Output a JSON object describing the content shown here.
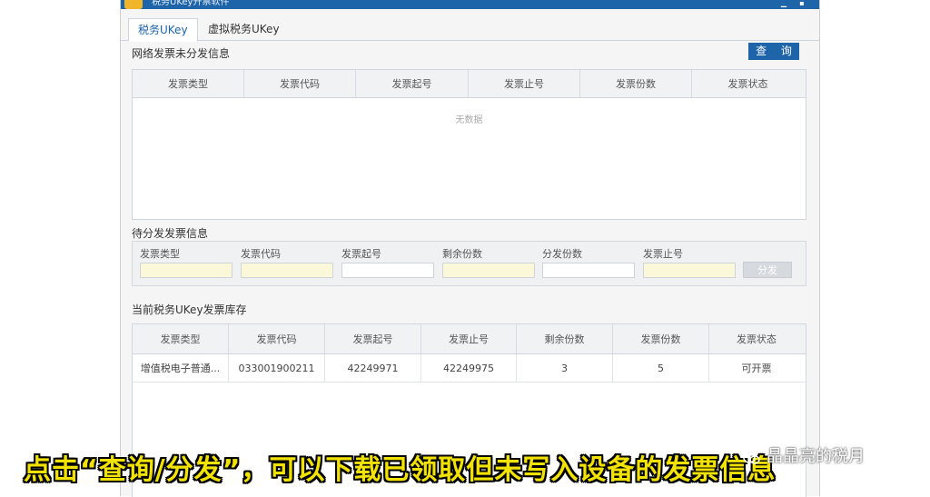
{
  "window": {
    "title": "税务UKey开票软件"
  },
  "tabs": [
    {
      "label": "税务UKey",
      "active": true
    },
    {
      "label": "虚拟税务UKey",
      "active": false
    }
  ],
  "undistributed": {
    "title": "网络发票未分发信息",
    "query_button": "查 询",
    "columns": [
      "发票类型",
      "发票代码",
      "发票起号",
      "发票止号",
      "发票份数",
      "发票状态"
    ],
    "empty_text": "无数据"
  },
  "pending": {
    "title": "待分发发票信息",
    "fields": [
      {
        "label": "发票类型",
        "value": ""
      },
      {
        "label": "发票代码",
        "value": ""
      },
      {
        "label": "发票起号",
        "value": ""
      },
      {
        "label": "剩余份数",
        "value": ""
      },
      {
        "label": "分发份数",
        "value": ""
      },
      {
        "label": "发票止号",
        "value": ""
      }
    ],
    "distribute_button": "分发"
  },
  "inventory": {
    "title": "当前税务UKey发票库存",
    "columns": [
      "发票类型",
      "发票代码",
      "发票起号",
      "发票止号",
      "剩余份数",
      "发票份数",
      "发票状态"
    ],
    "rows": [
      {
        "type": "增值税电子普通...",
        "code": "033001900211",
        "start": "42249971",
        "end": "42249975",
        "remaining": "3",
        "count": "5",
        "status": "可开票"
      }
    ]
  },
  "caption": {
    "text": "点击“查询/分发”，可以下载已领取但未写入设备的发票信息",
    "watermark": "晶晶亮的税月"
  },
  "colors": {
    "accent": "#1e64a8",
    "caption_yellow": "#f2e200"
  }
}
